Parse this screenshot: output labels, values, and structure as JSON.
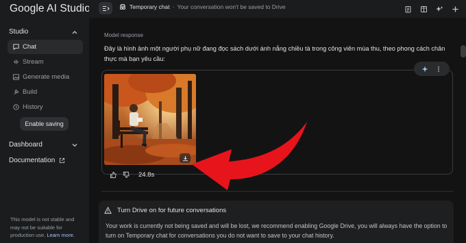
{
  "app": {
    "title": "Google AI Studio"
  },
  "sidebar": {
    "studio_label": "Studio",
    "items": [
      {
        "label": "Chat",
        "icon": "chat-icon",
        "active": true
      },
      {
        "label": "Stream",
        "icon": "stream-icon",
        "active": false
      },
      {
        "label": "Generate media",
        "icon": "media-icon",
        "active": false
      },
      {
        "label": "Build",
        "icon": "build-icon",
        "active": false
      },
      {
        "label": "History",
        "icon": "history-icon",
        "active": false
      }
    ],
    "enable_saving": "Enable saving",
    "dashboard_label": "Dashboard",
    "documentation_label": "Documentation",
    "warning_text": "This model is not stable and may not be suitable for production use.",
    "learn_more": "Learn more."
  },
  "topbar": {
    "chat_title": "Temporary chat",
    "separator": "·",
    "chat_subtitle": "Your conversation won't be saved to Drive"
  },
  "response": {
    "label": "Model response",
    "text": "Đây là hình ảnh một người phụ nữ đang đọc sách dưới ánh nắng chiều tà trong công viên mùa thu, theo phong cách chân thực mà bạn yêu cầu:",
    "timing": "24.8s"
  },
  "drive_notice": {
    "title": "Turn Drive on for future conversations",
    "body": "Your work is currently not being saved and will be lost, we recommend enabling Google Drive, you will always have the option to turn on Temporary chat for conversations you do not want to save to your chat history."
  },
  "colors": {
    "background": "#131314",
    "sidebar": "#1b1c1d",
    "annotation_arrow": "#e8141c",
    "link": "#a8c7fa"
  }
}
